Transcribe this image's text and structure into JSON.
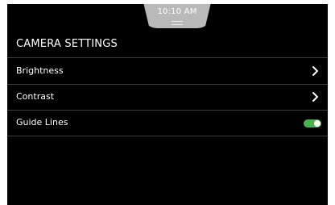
{
  "status_bar": {
    "time": "10:10 AM"
  },
  "header": {
    "title": "CAMERA SETTINGS"
  },
  "settings": {
    "items": [
      {
        "label": "Brightness",
        "control": "chevron-right-icon"
      },
      {
        "label": "Contrast",
        "control": "chevron-right-icon"
      },
      {
        "label": "Guide Lines",
        "control": "toggle",
        "toggle_on": true
      }
    ]
  },
  "colors": {
    "background": "#000000",
    "status_pill": "#b9b9b9",
    "toggle_on": "#4caf50",
    "divider": "#3a3a3a"
  }
}
